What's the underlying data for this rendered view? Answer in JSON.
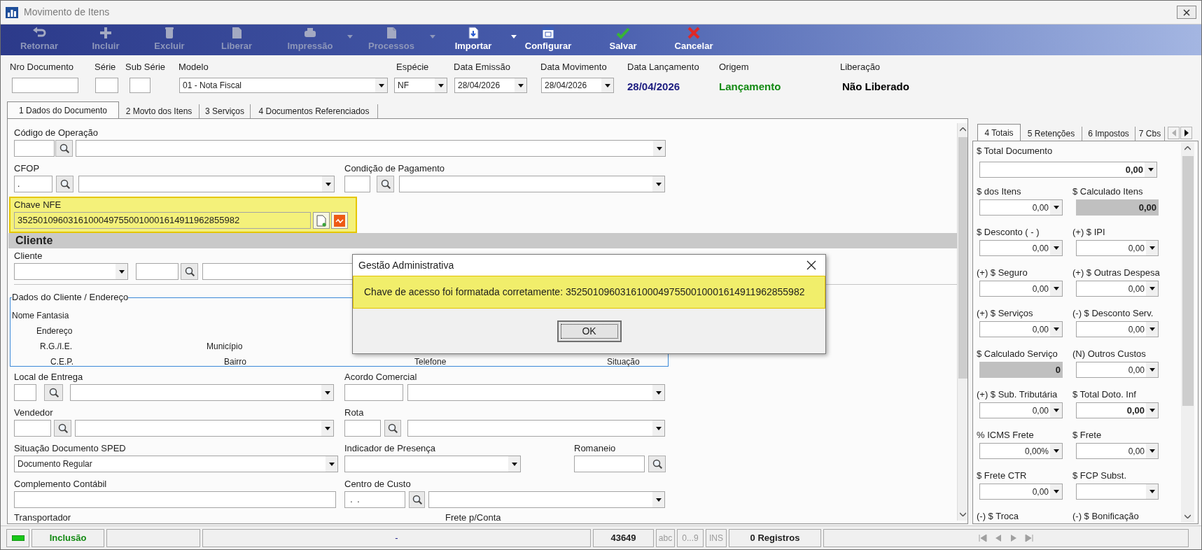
{
  "window": {
    "title": "Movimento de Itens"
  },
  "toolbar": [
    {
      "label": "Retornar",
      "disabled": true,
      "dropdown": false
    },
    {
      "label": "Incluir",
      "disabled": true,
      "dropdown": false
    },
    {
      "label": "Excluir",
      "disabled": true,
      "dropdown": false
    },
    {
      "label": "Liberar",
      "disabled": true,
      "dropdown": false
    },
    {
      "label": "Impressão",
      "disabled": true,
      "dropdown": true
    },
    {
      "label": "Processos",
      "disabled": true,
      "dropdown": true
    },
    {
      "label": "Importar",
      "disabled": false,
      "dropdown": true
    },
    {
      "label": "Configurar",
      "disabled": false,
      "dropdown": false
    },
    {
      "label": "Salvar",
      "disabled": false,
      "dropdown": false
    },
    {
      "label": "Cancelar",
      "disabled": false,
      "dropdown": false
    }
  ],
  "header": [
    {
      "label": "Nro Documento",
      "kind": "input"
    },
    {
      "label": "Série",
      "kind": "input"
    },
    {
      "label": "Sub Série",
      "kind": "input"
    },
    {
      "label": "Modelo",
      "kind": "combo",
      "value": "01 - Nota Fiscal"
    },
    {
      "label": "Espécie",
      "kind": "combo",
      "value": "NF"
    },
    {
      "label": "Data Emissão",
      "kind": "combo",
      "value": "28/04/2026"
    },
    {
      "label": "Data Movimento",
      "kind": "combo",
      "value": "28/04/2026"
    },
    {
      "label": "Data Lançamento",
      "kind": "display",
      "value": "28/04/2026",
      "color": "#1c1c80"
    },
    {
      "label": "Origem",
      "kind": "display",
      "value": "Lançamento",
      "color": "#138a13"
    },
    {
      "label": "Liberação",
      "kind": "display",
      "value": "Não Liberado",
      "color": "#000000"
    }
  ],
  "tabs": [
    {
      "label": "1 Dados do Documento",
      "selected": true
    },
    {
      "label": "2 Movto dos Itens",
      "selected": false
    },
    {
      "label": "3 Serviços",
      "selected": false
    },
    {
      "label": "4 Documentos Referenciados",
      "selected": false
    }
  ],
  "form": [
    {
      "kind": "fields",
      "groups": [
        {
          "label": "Código de Operação",
          "controls": [
            {
              "kind": "input"
            },
            {
              "kind": "search"
            },
            {
              "kind": "combo"
            }
          ]
        }
      ]
    },
    {
      "kind": "fields",
      "groups": [
        {
          "label": "CFOP",
          "controls": [
            {
              "kind": "input",
              "value": "."
            },
            {
              "kind": "search"
            },
            {
              "kind": "combo"
            }
          ]
        },
        {
          "label": "Condição de Pagamento",
          "controls": [
            {
              "kind": "input"
            },
            {
              "kind": "search"
            },
            {
              "kind": "combo"
            }
          ]
        }
      ]
    },
    {
      "kind": "key",
      "label": "Chave NFE",
      "value": "35250109603161000497550010001614911962855982"
    },
    {
      "kind": "band",
      "label": "Cliente"
    },
    {
      "kind": "fields",
      "groups": [
        {
          "label": "Cliente",
          "controls": [
            {
              "kind": "combo"
            },
            {
              "kind": "input"
            },
            {
              "kind": "search"
            },
            {
              "kind": "input"
            }
          ]
        }
      ]
    },
    {
      "kind": "groupbox",
      "title": "Dados do Cliente / Endereço",
      "labels": [
        "Nome Fantasia",
        "Endereço",
        "R.G./I.E.",
        "Município",
        "C.E.P.",
        "Bairro",
        "Telefone",
        "Situação"
      ]
    },
    {
      "kind": "fields",
      "groups": [
        {
          "label": "Local de Entrega",
          "controls": [
            {
              "kind": "input"
            },
            {
              "kind": "search"
            },
            {
              "kind": "combo"
            }
          ]
        },
        {
          "label": "Acordo Comercial",
          "controls": [
            {
              "kind": "input"
            },
            {
              "kind": "combo"
            }
          ]
        }
      ]
    },
    {
      "kind": "fields",
      "groups": [
        {
          "label": "Vendedor",
          "controls": [
            {
              "kind": "input"
            },
            {
              "kind": "search"
            },
            {
              "kind": "combo"
            }
          ]
        },
        {
          "label": "Rota",
          "controls": [
            {
              "kind": "input"
            },
            {
              "kind": "search"
            },
            {
              "kind": "combo"
            }
          ]
        }
      ]
    },
    {
      "kind": "fields",
      "groups": [
        {
          "label": "Situação Documento SPED",
          "controls": [
            {
              "kind": "combo",
              "value": "Documento Regular"
            }
          ]
        },
        {
          "label": "Indicador de Presença",
          "controls": [
            {
              "kind": "combo"
            }
          ]
        },
        {
          "label": "Romaneio",
          "controls": [
            {
              "kind": "input"
            },
            {
              "kind": "search"
            }
          ]
        }
      ]
    },
    {
      "kind": "fields",
      "groups": [
        {
          "label": "Complemento Contábil",
          "controls": [
            {
              "kind": "input"
            }
          ]
        },
        {
          "label": "Centro de Custo",
          "controls": [
            {
              "kind": "input",
              "value": " .  ."
            },
            {
              "kind": "search"
            },
            {
              "kind": "combo"
            }
          ]
        }
      ]
    },
    {
      "kind": "fields",
      "groups": [
        {
          "label": "Transportador"
        },
        {
          "label": "Frete p/Conta"
        }
      ]
    }
  ],
  "totals": {
    "tabs": [
      {
        "label": "4 Totais",
        "selected": true
      },
      {
        "label": "5 Retenções",
        "selected": false
      },
      {
        "label": "6 Impostos",
        "selected": false
      },
      {
        "label": "7 Cbs",
        "selected": false
      }
    ],
    "total": {
      "label": "$ Total Documento",
      "value": "0,00"
    },
    "fields": [
      {
        "label": "$ dos Itens",
        "kind": "dropdown",
        "value": "0,00",
        "bold": false
      },
      {
        "label": "$ Calculado Itens",
        "kind": "computed",
        "value": "0,00"
      },
      {
        "label": "$ Desconto ( - )",
        "kind": "dropdown",
        "value": "0,00",
        "bold": false
      },
      {
        "label": "(+) $ IPI",
        "kind": "dropdown",
        "value": "0,00",
        "bold": false
      },
      {
        "label": "(+) $ Seguro",
        "kind": "dropdown",
        "value": "0,00",
        "bold": false
      },
      {
        "label": "(+) $ Outras Despesa",
        "kind": "dropdown",
        "value": "0,00",
        "bold": false
      },
      {
        "label": "(+) $ Serviços",
        "kind": "dropdown",
        "value": "0,00",
        "bold": false
      },
      {
        "label": "(-) $ Desconto Serv.",
        "kind": "dropdown",
        "value": "0,00",
        "bold": false
      },
      {
        "label": "$ Calculado Serviço",
        "kind": "computed",
        "value": "0"
      },
      {
        "label": "(N) Outros Custos",
        "kind": "dropdown",
        "value": "0,00",
        "bold": false
      },
      {
        "label": "(+) $ Sub. Tributária",
        "kind": "dropdown",
        "value": "0,00",
        "bold": false
      },
      {
        "label": "$ Total Doto. Inf",
        "kind": "dropdown",
        "value": "0,00",
        "bold": true
      },
      {
        "label": "% ICMS Frete",
        "kind": "dropdown",
        "value": "0,00%",
        "bold": false
      },
      {
        "label": "$ Frete",
        "kind": "dropdown",
        "value": "0,00",
        "bold": false
      },
      {
        "label": "$ Frete CTR",
        "kind": "dropdown",
        "value": "0,00",
        "bold": false
      },
      {
        "label": "$ FCP Subst.",
        "kind": "dropdown"
      },
      {
        "label": "(-) $ Troca",
        "kind": "label"
      },
      {
        "label": "(-) $ Bonificação",
        "kind": "label"
      }
    ]
  },
  "dialog": {
    "title": "Gestão Administrativa",
    "message": "Chave de acesso foi formatada corretamente: 35250109603161000497550010001614911962855982",
    "buttons": [
      {
        "label": "OK",
        "focused": true
      }
    ]
  },
  "status_bar": {
    "mode": "Inclusão",
    "message": "-",
    "code": "43649",
    "indicators": [
      {
        "label": "abc",
        "on": false
      },
      {
        "label": "0...9",
        "on": false
      },
      {
        "label": "INS",
        "on": false
      }
    ],
    "records": "0 Registros"
  }
}
